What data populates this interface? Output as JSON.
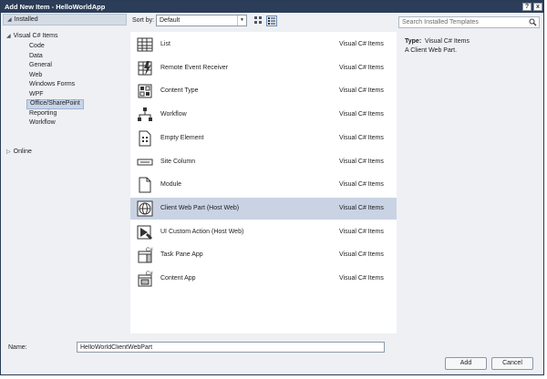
{
  "window": {
    "title": "Add New Item - HelloWorldApp",
    "help_label": "?",
    "close_label": "x"
  },
  "tree": {
    "installed_label": "Installed",
    "root_label": "Visual C# Items",
    "items": [
      {
        "label": "Code"
      },
      {
        "label": "Data"
      },
      {
        "label": "General"
      },
      {
        "label": "Web"
      },
      {
        "label": "Windows Forms"
      },
      {
        "label": "WPF"
      },
      {
        "label": "Office/SharePoint"
      },
      {
        "label": "Reporting"
      },
      {
        "label": "Workflow"
      }
    ],
    "selected": "Office/SharePoint",
    "online_label": "Online"
  },
  "sort": {
    "label": "Sort by:",
    "value": "Default"
  },
  "templates": [
    {
      "name": "List",
      "category": "Visual C# Items",
      "icon": "list-icon"
    },
    {
      "name": "Remote Event Receiver",
      "category": "Visual C# Items",
      "icon": "remote-event-receiver-icon"
    },
    {
      "name": "Content Type",
      "category": "Visual C# Items",
      "icon": "content-type-icon"
    },
    {
      "name": "Workflow",
      "category": "Visual C# Items",
      "icon": "workflow-icon"
    },
    {
      "name": "Empty Element",
      "category": "Visual C# Items",
      "icon": "empty-element-icon"
    },
    {
      "name": "Site Column",
      "category": "Visual C# Items",
      "icon": "site-column-icon"
    },
    {
      "name": "Module",
      "category": "Visual C# Items",
      "icon": "module-icon"
    },
    {
      "name": "Client Web Part (Host Web)",
      "category": "Visual C# Items",
      "icon": "client-web-part-icon"
    },
    {
      "name": "UI Custom Action (Host Web)",
      "category": "Visual C# Items",
      "icon": "ui-custom-action-icon"
    },
    {
      "name": "Task Pane App",
      "category": "Visual C# Items",
      "icon": "task-pane-app-icon"
    },
    {
      "name": "Content App",
      "category": "Visual C# Items",
      "icon": "content-app-icon"
    }
  ],
  "selected_template": "Client Web Part (Host Web)",
  "search": {
    "placeholder": "Search Installed Templates"
  },
  "info": {
    "type_label": "Type:",
    "type_value": "Visual C# Items",
    "description": "A Client Web Part."
  },
  "name_field": {
    "label": "Name:",
    "value": "HelloWorldClientWebPart"
  },
  "buttons": {
    "add": "Add",
    "cancel": "Cancel"
  },
  "colors": {
    "titlebar": "#2b3d58",
    "selection": "#c9d3e4",
    "dialog_bg": "#eef0f3"
  }
}
